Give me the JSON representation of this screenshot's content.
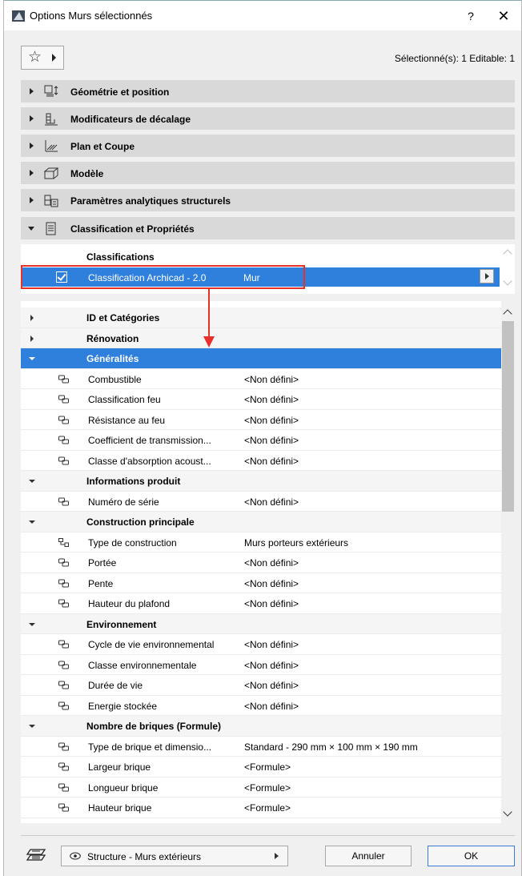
{
  "window": {
    "title": "Options Murs sélectionnés",
    "help": "?",
    "close": "✕"
  },
  "toolbar": {
    "favorites_icon": "star-icon",
    "selection_info": "Sélectionné(s): 1 Editable: 1"
  },
  "panels": [
    {
      "label": "Géométrie et position",
      "icon": "geometry-icon",
      "expanded": false
    },
    {
      "label": "Modificateurs de décalage",
      "icon": "offset-icon",
      "expanded": false
    },
    {
      "label": "Plan et Coupe",
      "icon": "floorplan-icon",
      "expanded": false
    },
    {
      "label": "Modèle",
      "icon": "model-icon",
      "expanded": false
    },
    {
      "label": "Paramètres analytiques structurels",
      "icon": "structural-icon",
      "expanded": false
    },
    {
      "label": "Classification et Propriétés",
      "icon": "classification-icon",
      "expanded": true
    }
  ],
  "classifications": {
    "header": "Classifications",
    "row": {
      "name": "Classification Archicad - 2.0",
      "value": "Mur",
      "checked": true
    }
  },
  "properties": [
    {
      "type": "group",
      "name": "ID et Catégories",
      "expanded": false
    },
    {
      "type": "group",
      "name": "Rénovation",
      "expanded": false
    },
    {
      "type": "group",
      "name": "Généralités",
      "expanded": true,
      "selected": true
    },
    {
      "type": "prop",
      "name": "Combustible",
      "value": "<Non défini>"
    },
    {
      "type": "prop",
      "name": "Classification feu",
      "value": "<Non défini>"
    },
    {
      "type": "prop",
      "name": "Résistance au feu",
      "value": "<Non défini>"
    },
    {
      "type": "prop",
      "name": "Coefficient de transmission...",
      "value": "<Non défini>"
    },
    {
      "type": "prop",
      "name": "Classe d'absorption acoust...",
      "value": "<Non défini>"
    },
    {
      "type": "group",
      "name": "Informations produit",
      "expanded": true
    },
    {
      "type": "prop",
      "name": "Numéro de série",
      "value": "<Non défini>"
    },
    {
      "type": "group",
      "name": "Construction principale",
      "expanded": true
    },
    {
      "type": "prop",
      "name": "Type de construction",
      "value": "Murs porteurs extérieurs",
      "icon": "option-set-icon"
    },
    {
      "type": "prop",
      "name": "Portée",
      "value": "<Non défini>"
    },
    {
      "type": "prop",
      "name": "Pente",
      "value": "<Non défini>"
    },
    {
      "type": "prop",
      "name": "Hauteur du plafond",
      "value": "<Non défini>"
    },
    {
      "type": "group",
      "name": "Environnement",
      "expanded": true
    },
    {
      "type": "prop",
      "name": "Cycle de vie environnemental",
      "value": "<Non défini>"
    },
    {
      "type": "prop",
      "name": "Classe environnementale",
      "value": "<Non défini>"
    },
    {
      "type": "prop",
      "name": "Durée de vie",
      "value": "<Non défini>"
    },
    {
      "type": "prop",
      "name": "Energie stockée",
      "value": "<Non défini>"
    },
    {
      "type": "group",
      "name": "Nombre de briques (Formule)",
      "expanded": true
    },
    {
      "type": "prop",
      "name": "Type de brique et dimensio...",
      "value": "Standard - 290 mm × 100 mm × 190 mm"
    },
    {
      "type": "prop",
      "name": "Largeur brique",
      "value": "<Formule>"
    },
    {
      "type": "prop",
      "name": "Longueur brique",
      "value": "<Formule>"
    },
    {
      "type": "prop",
      "name": "Hauteur brique",
      "value": "<Formule>"
    },
    {
      "type": "plain"
    },
    {
      "type": "plain"
    }
  ],
  "footer": {
    "layer": "Structure - Murs extérieurs",
    "cancel": "Annuler",
    "ok": "OK"
  },
  "colors": {
    "selection": "#2f7fdc",
    "callout": "#e8302a",
    "panel_header": "#d9d9d9"
  }
}
